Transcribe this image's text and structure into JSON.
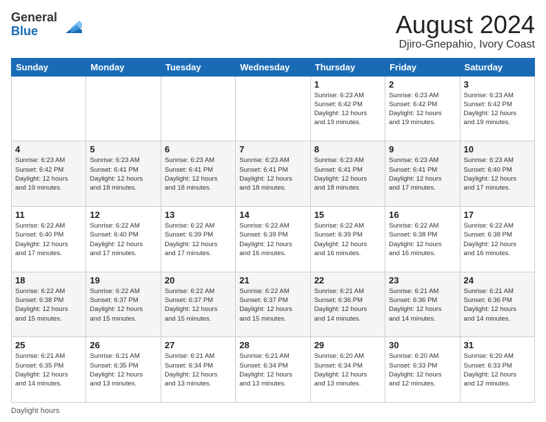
{
  "header": {
    "logo_general": "General",
    "logo_blue": "Blue",
    "month_year": "August 2024",
    "location": "Djiro-Gnepahio, Ivory Coast"
  },
  "days_of_week": [
    "Sunday",
    "Monday",
    "Tuesday",
    "Wednesday",
    "Thursday",
    "Friday",
    "Saturday"
  ],
  "weeks": [
    [
      {
        "day": "",
        "info": ""
      },
      {
        "day": "",
        "info": ""
      },
      {
        "day": "",
        "info": ""
      },
      {
        "day": "",
        "info": ""
      },
      {
        "day": "1",
        "info": "Sunrise: 6:23 AM\nSunset: 6:42 PM\nDaylight: 12 hours\nand 19 minutes."
      },
      {
        "day": "2",
        "info": "Sunrise: 6:23 AM\nSunset: 6:42 PM\nDaylight: 12 hours\nand 19 minutes."
      },
      {
        "day": "3",
        "info": "Sunrise: 6:23 AM\nSunset: 6:42 PM\nDaylight: 12 hours\nand 19 minutes."
      }
    ],
    [
      {
        "day": "4",
        "info": "Sunrise: 6:23 AM\nSunset: 6:42 PM\nDaylight: 12 hours\nand 19 minutes."
      },
      {
        "day": "5",
        "info": "Sunrise: 6:23 AM\nSunset: 6:41 PM\nDaylight: 12 hours\nand 18 minutes."
      },
      {
        "day": "6",
        "info": "Sunrise: 6:23 AM\nSunset: 6:41 PM\nDaylight: 12 hours\nand 18 minutes."
      },
      {
        "day": "7",
        "info": "Sunrise: 6:23 AM\nSunset: 6:41 PM\nDaylight: 12 hours\nand 18 minutes."
      },
      {
        "day": "8",
        "info": "Sunrise: 6:23 AM\nSunset: 6:41 PM\nDaylight: 12 hours\nand 18 minutes."
      },
      {
        "day": "9",
        "info": "Sunrise: 6:23 AM\nSunset: 6:41 PM\nDaylight: 12 hours\nand 17 minutes."
      },
      {
        "day": "10",
        "info": "Sunrise: 6:23 AM\nSunset: 6:40 PM\nDaylight: 12 hours\nand 17 minutes."
      }
    ],
    [
      {
        "day": "11",
        "info": "Sunrise: 6:22 AM\nSunset: 6:40 PM\nDaylight: 12 hours\nand 17 minutes."
      },
      {
        "day": "12",
        "info": "Sunrise: 6:22 AM\nSunset: 6:40 PM\nDaylight: 12 hours\nand 17 minutes."
      },
      {
        "day": "13",
        "info": "Sunrise: 6:22 AM\nSunset: 6:39 PM\nDaylight: 12 hours\nand 17 minutes."
      },
      {
        "day": "14",
        "info": "Sunrise: 6:22 AM\nSunset: 6:39 PM\nDaylight: 12 hours\nand 16 minutes."
      },
      {
        "day": "15",
        "info": "Sunrise: 6:22 AM\nSunset: 6:39 PM\nDaylight: 12 hours\nand 16 minutes."
      },
      {
        "day": "16",
        "info": "Sunrise: 6:22 AM\nSunset: 6:38 PM\nDaylight: 12 hours\nand 16 minutes."
      },
      {
        "day": "17",
        "info": "Sunrise: 6:22 AM\nSunset: 6:38 PM\nDaylight: 12 hours\nand 16 minutes."
      }
    ],
    [
      {
        "day": "18",
        "info": "Sunrise: 6:22 AM\nSunset: 6:38 PM\nDaylight: 12 hours\nand 15 minutes."
      },
      {
        "day": "19",
        "info": "Sunrise: 6:22 AM\nSunset: 6:37 PM\nDaylight: 12 hours\nand 15 minutes."
      },
      {
        "day": "20",
        "info": "Sunrise: 6:22 AM\nSunset: 6:37 PM\nDaylight: 12 hours\nand 15 minutes."
      },
      {
        "day": "21",
        "info": "Sunrise: 6:22 AM\nSunset: 6:37 PM\nDaylight: 12 hours\nand 15 minutes."
      },
      {
        "day": "22",
        "info": "Sunrise: 6:21 AM\nSunset: 6:36 PM\nDaylight: 12 hours\nand 14 minutes."
      },
      {
        "day": "23",
        "info": "Sunrise: 6:21 AM\nSunset: 6:36 PM\nDaylight: 12 hours\nand 14 minutes."
      },
      {
        "day": "24",
        "info": "Sunrise: 6:21 AM\nSunset: 6:36 PM\nDaylight: 12 hours\nand 14 minutes."
      }
    ],
    [
      {
        "day": "25",
        "info": "Sunrise: 6:21 AM\nSunset: 6:35 PM\nDaylight: 12 hours\nand 14 minutes."
      },
      {
        "day": "26",
        "info": "Sunrise: 6:21 AM\nSunset: 6:35 PM\nDaylight: 12 hours\nand 13 minutes."
      },
      {
        "day": "27",
        "info": "Sunrise: 6:21 AM\nSunset: 6:34 PM\nDaylight: 12 hours\nand 13 minutes."
      },
      {
        "day": "28",
        "info": "Sunrise: 6:21 AM\nSunset: 6:34 PM\nDaylight: 12 hours\nand 13 minutes."
      },
      {
        "day": "29",
        "info": "Sunrise: 6:20 AM\nSunset: 6:34 PM\nDaylight: 12 hours\nand 13 minutes."
      },
      {
        "day": "30",
        "info": "Sunrise: 6:20 AM\nSunset: 6:33 PM\nDaylight: 12 hours\nand 12 minutes."
      },
      {
        "day": "31",
        "info": "Sunrise: 6:20 AM\nSunset: 6:33 PM\nDaylight: 12 hours\nand 12 minutes."
      }
    ]
  ],
  "footer": {
    "daylight_label": "Daylight hours"
  }
}
